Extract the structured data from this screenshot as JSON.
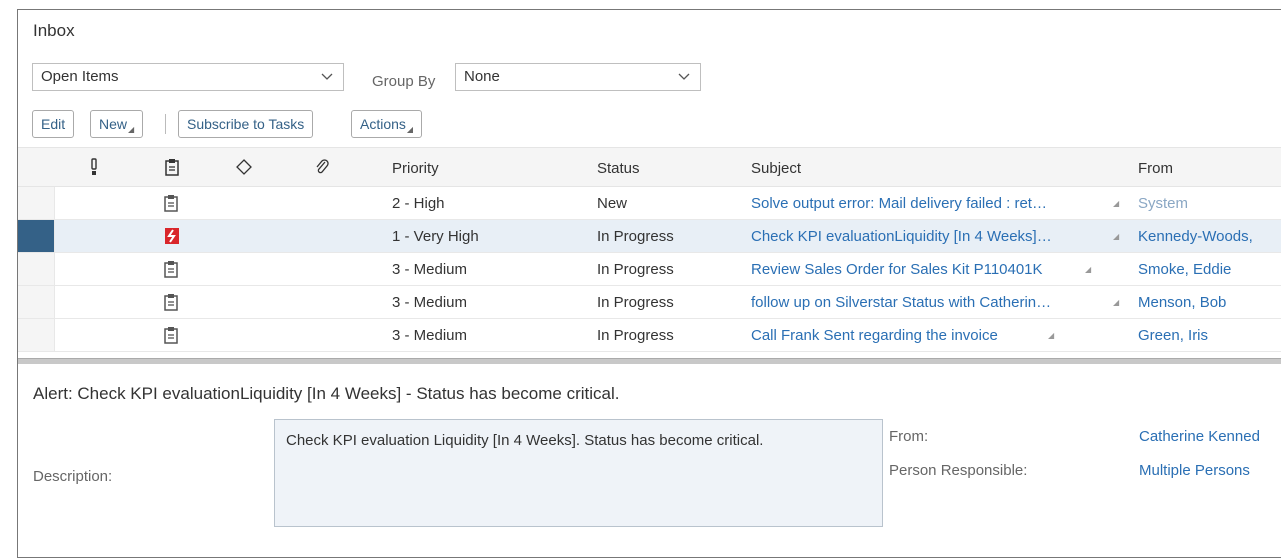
{
  "inbox": {
    "title": "Inbox"
  },
  "filters": {
    "view_value": "Open Items",
    "group_by_label": "Group By",
    "group_by_value": "None"
  },
  "toolbar": {
    "edit_label": "Edit",
    "new_label": "New",
    "subscribe_label": "Subscribe to Tasks",
    "actions_label": "Actions"
  },
  "table": {
    "columns": {
      "priority": "Priority",
      "status": "Status",
      "subject": "Subject",
      "from": "From"
    },
    "header_icons": [
      "exclamation-icon",
      "task-icon",
      "tag-icon",
      "paperclip-icon"
    ],
    "rows": [
      {
        "priority": "2 - High",
        "status": "New",
        "subject": "Solve output error: Mail delivery failed : ret…",
        "from": "System",
        "icon": "task-icon",
        "selected": false
      },
      {
        "priority": "1 - Very High",
        "status": "In Progress",
        "subject": "Check KPI evaluationLiquidity [In 4 Weeks]…",
        "from": "Kennedy-Woods,",
        "icon": "alert-icon",
        "selected": true
      },
      {
        "priority": "3 - Medium",
        "status": "In Progress",
        "subject": "Review Sales Order for Sales Kit P110401K",
        "from": "Smoke, Eddie",
        "icon": "task-icon",
        "selected": false
      },
      {
        "priority": "3 - Medium",
        "status": "In Progress",
        "subject": "follow up on Silverstar Status with Catherin…",
        "from": "Menson, Bob",
        "icon": "task-icon",
        "selected": false
      },
      {
        "priority": "3 - Medium",
        "status": "In Progress",
        "subject": "Call Frank Sent regarding the invoice",
        "from": "Green, Iris",
        "icon": "task-icon",
        "selected": false
      }
    ]
  },
  "detail": {
    "alert_title": "Alert: Check KPI evaluationLiquidity [In 4 Weeks] - Status has become critical.",
    "description_label": "Description:",
    "description_text": "Check KPI evaluation Liquidity [In 4 Weeks]. Status has become critical.",
    "from_label": "From:",
    "from_value": "Catherine Kenned",
    "person_label": "Person Responsible:",
    "person_value": "Multiple Persons"
  },
  "colors": {
    "accent": "#346187",
    "link": "#2a6fb4",
    "selected_row": "#e8eff6",
    "alert_icon": "#d9262b"
  }
}
